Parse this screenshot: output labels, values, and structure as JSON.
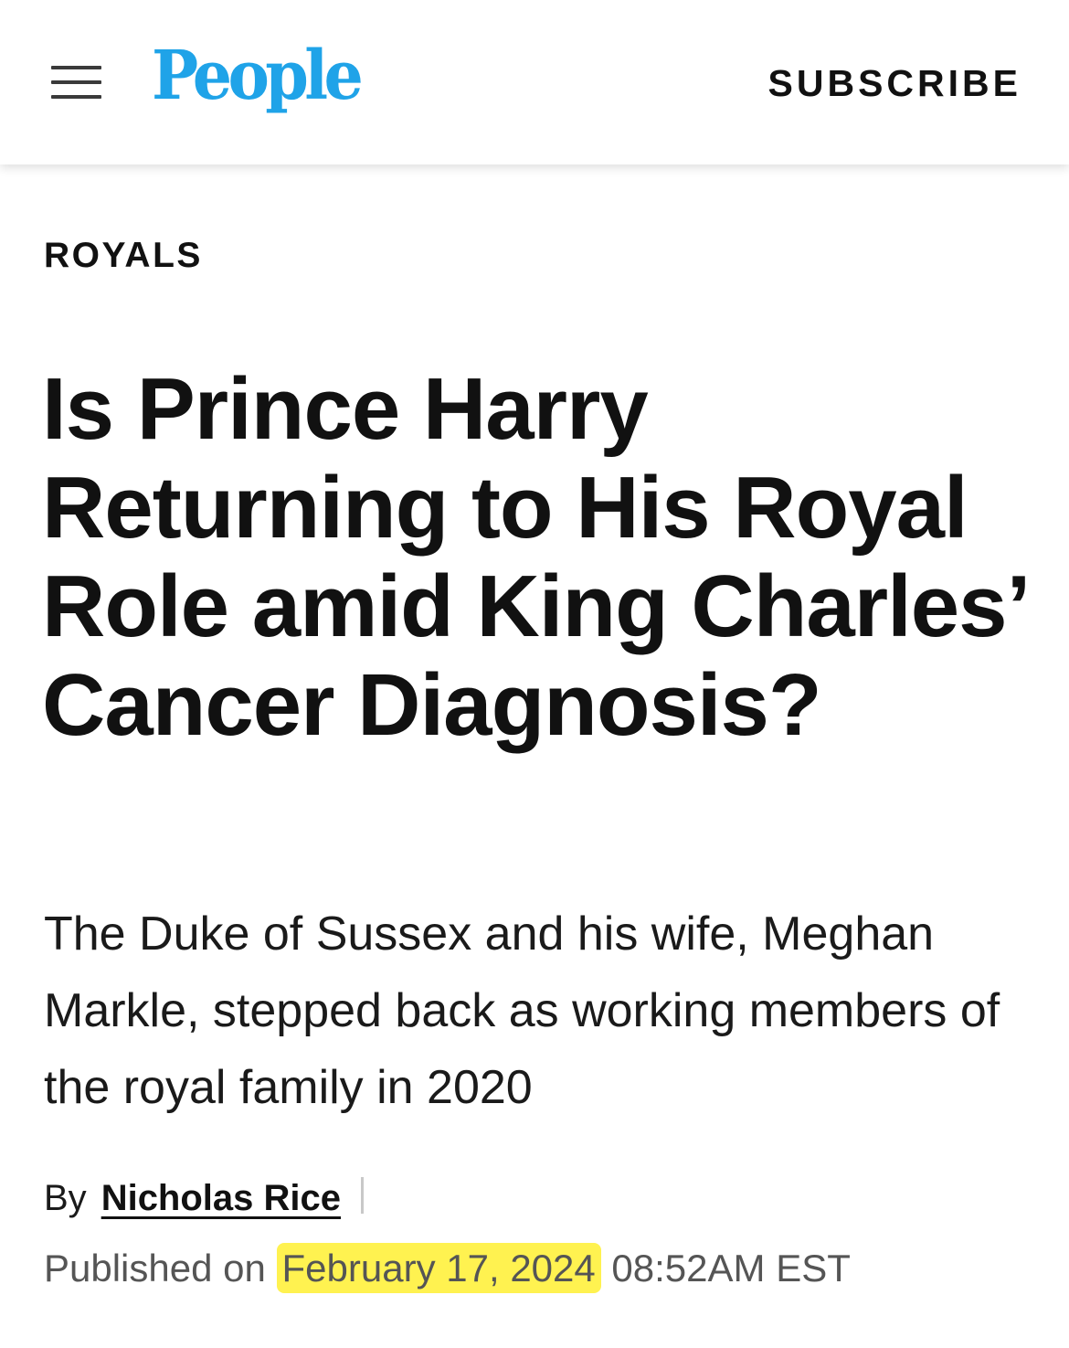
{
  "header": {
    "logo_text": "People",
    "subscribe_label": "SUBSCRIBE",
    "menu_icon": "hamburger-menu-icon",
    "logo_color": "#1fa3e8"
  },
  "article": {
    "category": "ROYALS",
    "headline": "Is Prince Harry Returning to His Royal Role amid King Charles’ Cancer Diagnosis?",
    "dek": "The Duke of Sussex and his wife, Meghan Markle, stepped back as working members of the royal family in 2020",
    "byline_prefix": "By",
    "author": "Nicholas Rice",
    "published_prefix": "Published on",
    "published_date": "February 17, 2024",
    "published_time": "08:52AM EST",
    "highlight_color": "#fff250"
  }
}
